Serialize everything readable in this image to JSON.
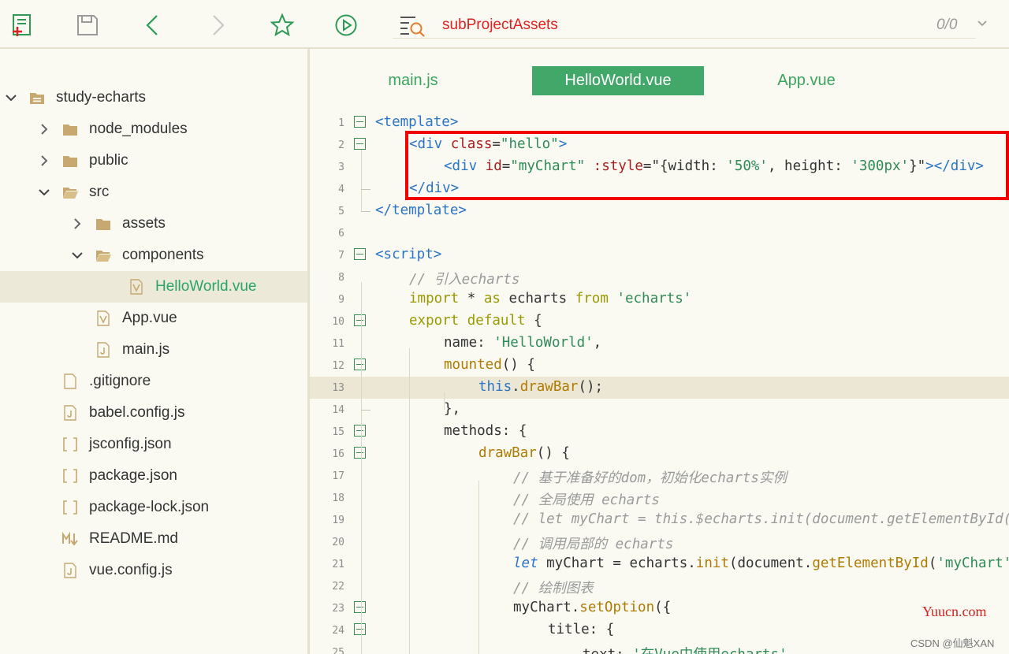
{
  "toolbar": {
    "buttons": [
      {
        "name": "new-file-icon"
      },
      {
        "name": "save-icon"
      },
      {
        "name": "back-icon"
      },
      {
        "name": "forward-icon"
      },
      {
        "name": "star-icon"
      },
      {
        "name": "run-icon"
      },
      {
        "name": "search-in-files-icon"
      }
    ],
    "search_text": "subProjectAssets",
    "search_count": "0/0"
  },
  "sidebar": {
    "items": [
      {
        "label": "study-echarts",
        "type": "project",
        "expanded": true
      },
      {
        "label": "node_modules",
        "type": "folder",
        "expanded": false
      },
      {
        "label": "public",
        "type": "folder",
        "expanded": false
      },
      {
        "label": "src",
        "type": "folder",
        "expanded": true
      },
      {
        "label": "assets",
        "type": "folder",
        "expanded": false
      },
      {
        "label": "components",
        "type": "folder",
        "expanded": true
      },
      {
        "label": "HelloWorld.vue",
        "type": "vue",
        "selected": true
      },
      {
        "label": "App.vue",
        "type": "vue"
      },
      {
        "label": "main.js",
        "type": "js"
      },
      {
        "label": ".gitignore",
        "type": "file"
      },
      {
        "label": "babel.config.js",
        "type": "js"
      },
      {
        "label": "jsconfig.json",
        "type": "json"
      },
      {
        "label": "package.json",
        "type": "json"
      },
      {
        "label": "package-lock.json",
        "type": "json"
      },
      {
        "label": "README.md",
        "type": "md"
      },
      {
        "label": "vue.config.js",
        "type": "js"
      }
    ]
  },
  "tabs": [
    {
      "label": "main.js",
      "active": false
    },
    {
      "label": "HelloWorld.vue",
      "active": true
    },
    {
      "label": "App.vue",
      "active": false
    }
  ],
  "code": {
    "lines": [
      {
        "n": "1",
        "fold": true
      },
      {
        "n": "2",
        "fold": true
      },
      {
        "n": "3",
        "fold": false
      },
      {
        "n": "4",
        "fold": false
      },
      {
        "n": "5",
        "fold": false
      },
      {
        "n": "6",
        "fold": false
      },
      {
        "n": "7",
        "fold": true
      },
      {
        "n": "8",
        "fold": false
      },
      {
        "n": "9",
        "fold": false
      },
      {
        "n": "10",
        "fold": true
      },
      {
        "n": "11",
        "fold": false
      },
      {
        "n": "12",
        "fold": true
      },
      {
        "n": "13",
        "fold": false
      },
      {
        "n": "14",
        "fold": false
      },
      {
        "n": "15",
        "fold": true
      },
      {
        "n": "16",
        "fold": true
      },
      {
        "n": "17",
        "fold": false
      },
      {
        "n": "18",
        "fold": false
      },
      {
        "n": "19",
        "fold": false
      },
      {
        "n": "20",
        "fold": false
      },
      {
        "n": "21",
        "fold": false
      },
      {
        "n": "22",
        "fold": false
      },
      {
        "n": "23",
        "fold": true
      },
      {
        "n": "24",
        "fold": true
      },
      {
        "n": "25",
        "fold": false
      }
    ],
    "tokens": {
      "l1": [
        "<template>"
      ],
      "l2": [
        "<div",
        " class",
        "=",
        "\"hello\"",
        ">"
      ],
      "l3": [
        "<div",
        " id",
        "=",
        "\"myChart\"",
        " :style",
        "=",
        "\"{width: ",
        "'50%'",
        ", height: ",
        "'300px'",
        "}\"",
        "></div>"
      ],
      "l4": [
        "</div>"
      ],
      "l5": [
        "</template>"
      ],
      "l7": [
        "<script>"
      ],
      "l8": [
        "// 引入echarts"
      ],
      "l9": [
        "import",
        " * ",
        "as",
        " echarts ",
        "from",
        " ",
        "'echarts'"
      ],
      "l10": [
        "export",
        " ",
        "default",
        " {"
      ],
      "l11": [
        "name: ",
        "'HelloWorld'",
        ","
      ],
      "l12": [
        "mounted",
        "() {"
      ],
      "l13": [
        "this",
        ".",
        "drawBar",
        "();"
      ],
      "l14": [
        "},"
      ],
      "l15": [
        "methods: {"
      ],
      "l16": [
        "drawBar",
        "() {"
      ],
      "l17": [
        "// 基于准备好的dom，初始化echarts实例"
      ],
      "l18": [
        "// 全局使用 echarts"
      ],
      "l19": [
        "// let myChart = this.$echarts.init(document.getElementById('myChart'))"
      ],
      "l20": [
        "// 调用局部的 echarts"
      ],
      "l21": [
        "let",
        " myChart = echarts.",
        "init",
        "(document.",
        "getElementById",
        "(",
        "'myChart'",
        "))"
      ],
      "l22": [
        "// 绘制图表"
      ],
      "l23": [
        "myChart.",
        "setOption",
        "({"
      ],
      "l24": [
        "title: {"
      ],
      "l25": [
        "text: ",
        "'在Vue中使用echarts'",
        ","
      ]
    }
  },
  "watermark": {
    "site": "Yuucn.com",
    "credit": "CSDN @仙魁XAN"
  },
  "colors": {
    "accent_green": "#42a869",
    "search_red": "#e02020",
    "highlight_box": "#f00000"
  }
}
